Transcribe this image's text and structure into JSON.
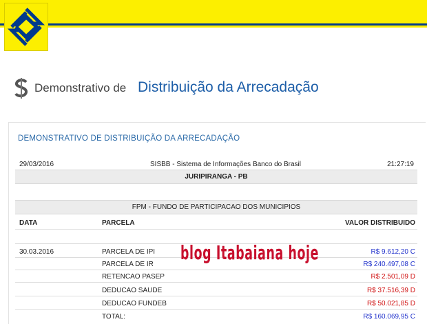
{
  "header": {
    "title_prefix": "Demonstrativo de",
    "title_main": "Distribuição da Arrecadação"
  },
  "panel": {
    "title": "DEMONSTRATIVO DE DISTRIBUIÇÃO DA ARRECADAÇÃO",
    "date": "29/03/2016",
    "system": "SISBB - Sistema de Informações Banco do Brasil",
    "time": "21:27:19",
    "municipality": "JURIPIRANGA - PB",
    "fund": "FPM - FUNDO DE PARTICIPACAO DOS MUNICIPIOS",
    "columns": [
      "DATA",
      "PARCELA",
      "VALOR DISTRIBUIDO"
    ],
    "rows": [
      {
        "date": "30.03.2016",
        "parcela": "PARCELA DE IPI",
        "valor": "R$ 9.612,20 C"
      },
      {
        "date": "",
        "parcela": "PARCELA DE IR",
        "valor": "R$ 240.497,08 C"
      },
      {
        "date": "",
        "parcela": "RETENCAO PASEP",
        "valor": "R$ 2.501,09 D"
      },
      {
        "date": "",
        "parcela": "DEDUCAO SAUDE",
        "valor": "R$ 37.516,39 D"
      },
      {
        "date": "",
        "parcela": "DEDUCAO FUNDEB",
        "valor": "R$ 50.021,85 D"
      },
      {
        "date": "",
        "parcela": "TOTAL:",
        "valor": "R$ 160.069,95 C"
      }
    ]
  },
  "watermark": "blog Itabaiana hoje",
  "colors": {
    "brand_yellow": "#fcef00",
    "brand_blue": "#003a8c",
    "credit": "#2233cc",
    "debit": "#d01010"
  }
}
